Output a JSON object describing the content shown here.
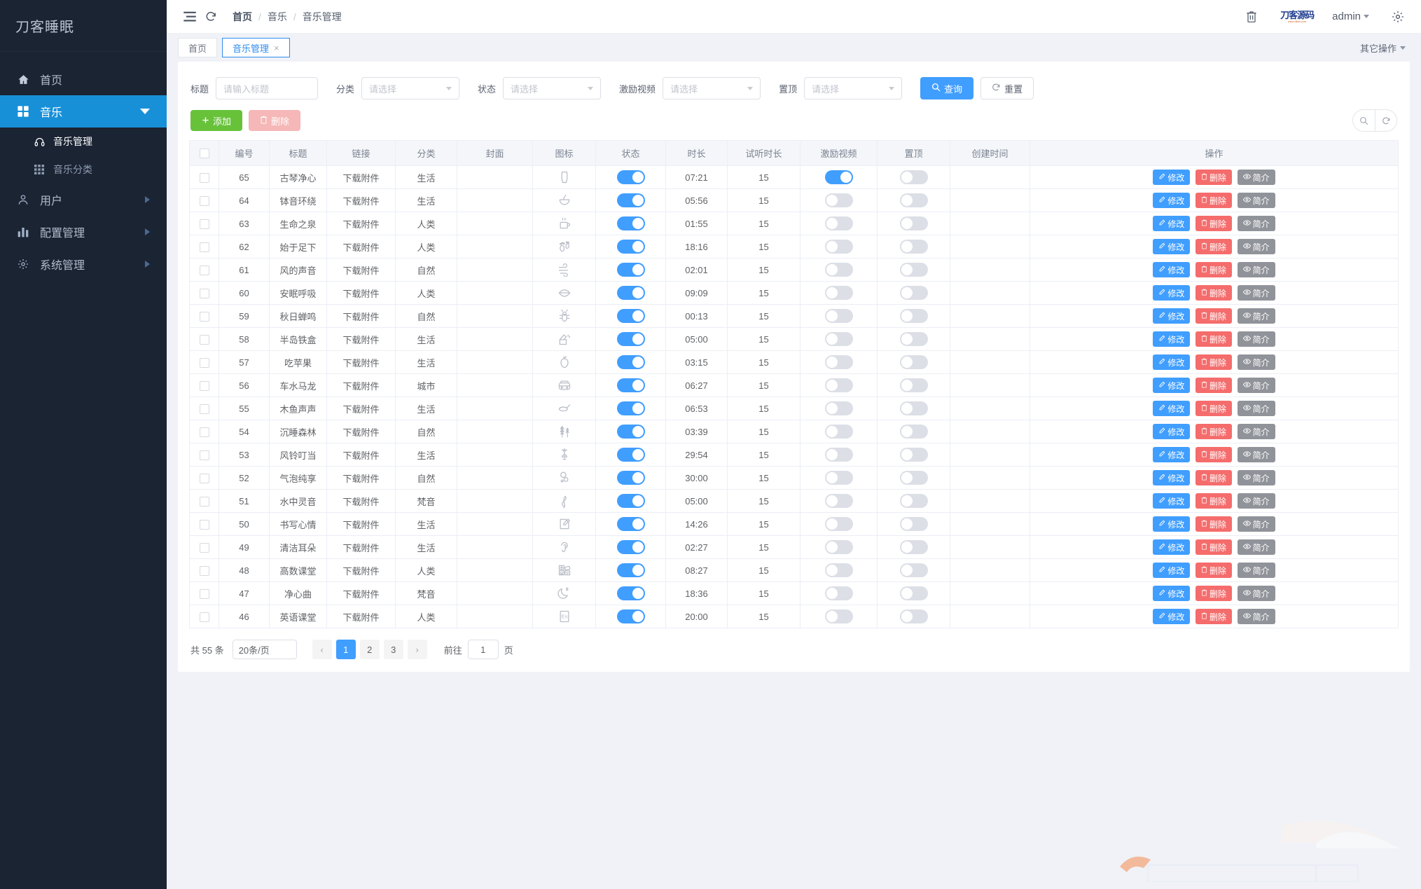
{
  "sidebar": {
    "brand": "刀客睡眠",
    "items": [
      {
        "label": "首页",
        "icon": "home-icon",
        "state": "normal",
        "arrow": "none"
      },
      {
        "label": "音乐",
        "icon": "grid-icon",
        "state": "active",
        "arrow": "down"
      },
      {
        "label": "用户",
        "icon": "user-icon",
        "state": "normal",
        "arrow": "right"
      },
      {
        "label": "配置管理",
        "icon": "bar-chart-icon",
        "state": "normal",
        "arrow": "right"
      },
      {
        "label": "系统管理",
        "icon": "gear-icon",
        "state": "normal",
        "arrow": "right"
      }
    ],
    "sub_items": [
      {
        "label": "音乐管理",
        "icon": "headphone-icon",
        "current": true
      },
      {
        "label": "音乐分类",
        "icon": "grid-small-icon",
        "current": false
      }
    ]
  },
  "header": {
    "menu_icon": "hamburger-icon",
    "refresh_icon": "refresh-icon",
    "breadcrumb": [
      "首页",
      "音乐",
      "音乐管理"
    ],
    "trash_icon": "trash-icon",
    "logo_main": "刀客源码",
    "logo_sub": "www.dkwl.com",
    "user": "admin",
    "settings_icon": "gear-icon"
  },
  "tabs": {
    "items": [
      {
        "label": "首页",
        "active": false,
        "closable": false
      },
      {
        "label": "音乐管理",
        "active": true,
        "closable": true
      }
    ],
    "close_glyph": "×",
    "other_ops": "其它操作"
  },
  "filters": {
    "fields": [
      {
        "label": "标题",
        "type": "input",
        "placeholder": "请输入标题",
        "value": ""
      },
      {
        "label": "分类",
        "type": "select",
        "placeholder": "请选择",
        "value": ""
      },
      {
        "label": "状态",
        "type": "select",
        "placeholder": "请选择",
        "value": ""
      },
      {
        "label": "激励视频",
        "type": "select",
        "placeholder": "请选择",
        "value": ""
      },
      {
        "label": "置顶",
        "type": "select",
        "placeholder": "请选择",
        "value": ""
      }
    ],
    "search_label": "查询",
    "search_icon": "search-icon",
    "reset_label": "重置",
    "reset_icon": "refresh-icon"
  },
  "toolbar": {
    "add_label": "添加",
    "add_icon": "plus-icon",
    "delete_label": "删除",
    "delete_icon": "trash-icon",
    "search_round_icon": "search-icon",
    "refresh_round_icon": "refresh-icon"
  },
  "table": {
    "columns": [
      "编号",
      "标题",
      "链接",
      "分类",
      "封面",
      "图标",
      "状态",
      "时长",
      "试听时长",
      "激励视频",
      "置顶",
      "创建时间",
      "操作"
    ],
    "link_text": "下载附件",
    "actions": {
      "edit": "修改",
      "edit_icon": "pencil-icon",
      "delete": "删除",
      "delete_icon": "trash-icon",
      "info": "简介",
      "info_icon": "eye-icon"
    },
    "rows": [
      {
        "id": "65",
        "title": "古琴净心",
        "link": "下载附件",
        "category": "生活",
        "cover": "",
        "icon": "lyre-icon",
        "status": true,
        "duration": "07:21",
        "preview": "15",
        "reward": true,
        "top": false,
        "created": ""
      },
      {
        "id": "64",
        "title": "钵音环绕",
        "link": "下载附件",
        "category": "生活",
        "cover": "",
        "icon": "mortar-pestle-icon",
        "status": true,
        "duration": "05:56",
        "preview": "15",
        "reward": false,
        "top": false,
        "created": ""
      },
      {
        "id": "63",
        "title": "生命之泉",
        "link": "下载附件",
        "category": "人类",
        "cover": "",
        "icon": "hot-cup-icon",
        "status": true,
        "duration": "01:55",
        "preview": "15",
        "reward": false,
        "top": false,
        "created": ""
      },
      {
        "id": "62",
        "title": "始于足下",
        "link": "下载附件",
        "category": "人类",
        "cover": "",
        "icon": "footprints-icon",
        "status": true,
        "duration": "18:16",
        "preview": "15",
        "reward": false,
        "top": false,
        "created": ""
      },
      {
        "id": "61",
        "title": "风的声音",
        "link": "下载附件",
        "category": "自然",
        "cover": "",
        "icon": "wind-icon",
        "status": true,
        "duration": "02:01",
        "preview": "15",
        "reward": false,
        "top": false,
        "created": ""
      },
      {
        "id": "60",
        "title": "安眠呼吸",
        "link": "下载附件",
        "category": "人类",
        "cover": "",
        "icon": "mouth-icon",
        "status": true,
        "duration": "09:09",
        "preview": "15",
        "reward": false,
        "top": false,
        "created": ""
      },
      {
        "id": "59",
        "title": "秋日蝉鸣",
        "link": "下载附件",
        "category": "自然",
        "cover": "",
        "icon": "bug-icon",
        "status": true,
        "duration": "00:13",
        "preview": "15",
        "reward": false,
        "top": false,
        "created": ""
      },
      {
        "id": "58",
        "title": "半岛铁盒",
        "link": "下载附件",
        "category": "生活",
        "cover": "",
        "icon": "music-box-icon",
        "status": true,
        "duration": "05:00",
        "preview": "15",
        "reward": false,
        "top": false,
        "created": ""
      },
      {
        "id": "57",
        "title": "吃苹果",
        "link": "下载附件",
        "category": "生活",
        "cover": "",
        "icon": "apple-icon",
        "status": true,
        "duration": "03:15",
        "preview": "15",
        "reward": false,
        "top": false,
        "created": ""
      },
      {
        "id": "56",
        "title": "车水马龙",
        "link": "下载附件",
        "category": "城市",
        "cover": "",
        "icon": "car-icon",
        "status": true,
        "duration": "06:27",
        "preview": "15",
        "reward": false,
        "top": false,
        "created": ""
      },
      {
        "id": "55",
        "title": "木鱼声声",
        "link": "下载附件",
        "category": "生活",
        "cover": "",
        "icon": "wooden-fish-icon",
        "status": true,
        "duration": "06:53",
        "preview": "15",
        "reward": false,
        "top": false,
        "created": ""
      },
      {
        "id": "54",
        "title": "沉睡森林",
        "link": "下载附件",
        "category": "自然",
        "cover": "",
        "icon": "forest-icon",
        "status": true,
        "duration": "03:39",
        "preview": "15",
        "reward": false,
        "top": false,
        "created": ""
      },
      {
        "id": "53",
        "title": "风铃叮当",
        "link": "下载附件",
        "category": "生活",
        "cover": "",
        "icon": "wind-chime-icon",
        "status": true,
        "duration": "29:54",
        "preview": "15",
        "reward": false,
        "top": false,
        "created": ""
      },
      {
        "id": "52",
        "title": "气泡纯享",
        "link": "下载附件",
        "category": "自然",
        "cover": "",
        "icon": "bubbles-icon",
        "status": true,
        "duration": "30:00",
        "preview": "15",
        "reward": false,
        "top": false,
        "created": ""
      },
      {
        "id": "51",
        "title": "水中灵音",
        "link": "下载附件",
        "category": "梵音",
        "cover": "",
        "icon": "treble-clef-icon",
        "status": true,
        "duration": "05:00",
        "preview": "15",
        "reward": false,
        "top": false,
        "created": ""
      },
      {
        "id": "50",
        "title": "书写心情",
        "link": "下载附件",
        "category": "生活",
        "cover": "",
        "icon": "write-note-icon",
        "status": true,
        "duration": "14:26",
        "preview": "15",
        "reward": false,
        "top": false,
        "created": ""
      },
      {
        "id": "49",
        "title": "清洁耳朵",
        "link": "下载附件",
        "category": "生活",
        "cover": "",
        "icon": "ear-icon",
        "status": true,
        "duration": "02:27",
        "preview": "15",
        "reward": false,
        "top": false,
        "created": ""
      },
      {
        "id": "48",
        "title": "高数课堂",
        "link": "下载附件",
        "category": "人类",
        "cover": "",
        "icon": "calculator-icon",
        "status": true,
        "duration": "08:27",
        "preview": "15",
        "reward": false,
        "top": false,
        "created": ""
      },
      {
        "id": "47",
        "title": "净心曲",
        "link": "下载附件",
        "category": "梵音",
        "cover": "",
        "icon": "moon-sleep-icon",
        "status": true,
        "duration": "18:36",
        "preview": "15",
        "reward": false,
        "top": false,
        "created": ""
      },
      {
        "id": "46",
        "title": "英语课堂",
        "link": "下载附件",
        "category": "人类",
        "cover": "",
        "icon": "english-icon",
        "status": true,
        "duration": "20:00",
        "preview": "15",
        "reward": false,
        "top": false,
        "created": ""
      }
    ]
  },
  "pagination": {
    "total_text": "共 55 条",
    "page_size": "20条/页",
    "prev_glyph": "‹",
    "next_glyph": "›",
    "pages": [
      "1",
      "2",
      "3"
    ],
    "current_page": "1",
    "jump_prefix": "前往",
    "jump_value": "1",
    "jump_suffix": "页"
  },
  "colors": {
    "sidebar_bg": "#1b2433",
    "sidebar_active": "#1890d8",
    "primary": "#409eff",
    "danger": "#f56c6c",
    "success": "#67c23a",
    "info": "#909399",
    "page_bg": "#f0f2f7"
  }
}
